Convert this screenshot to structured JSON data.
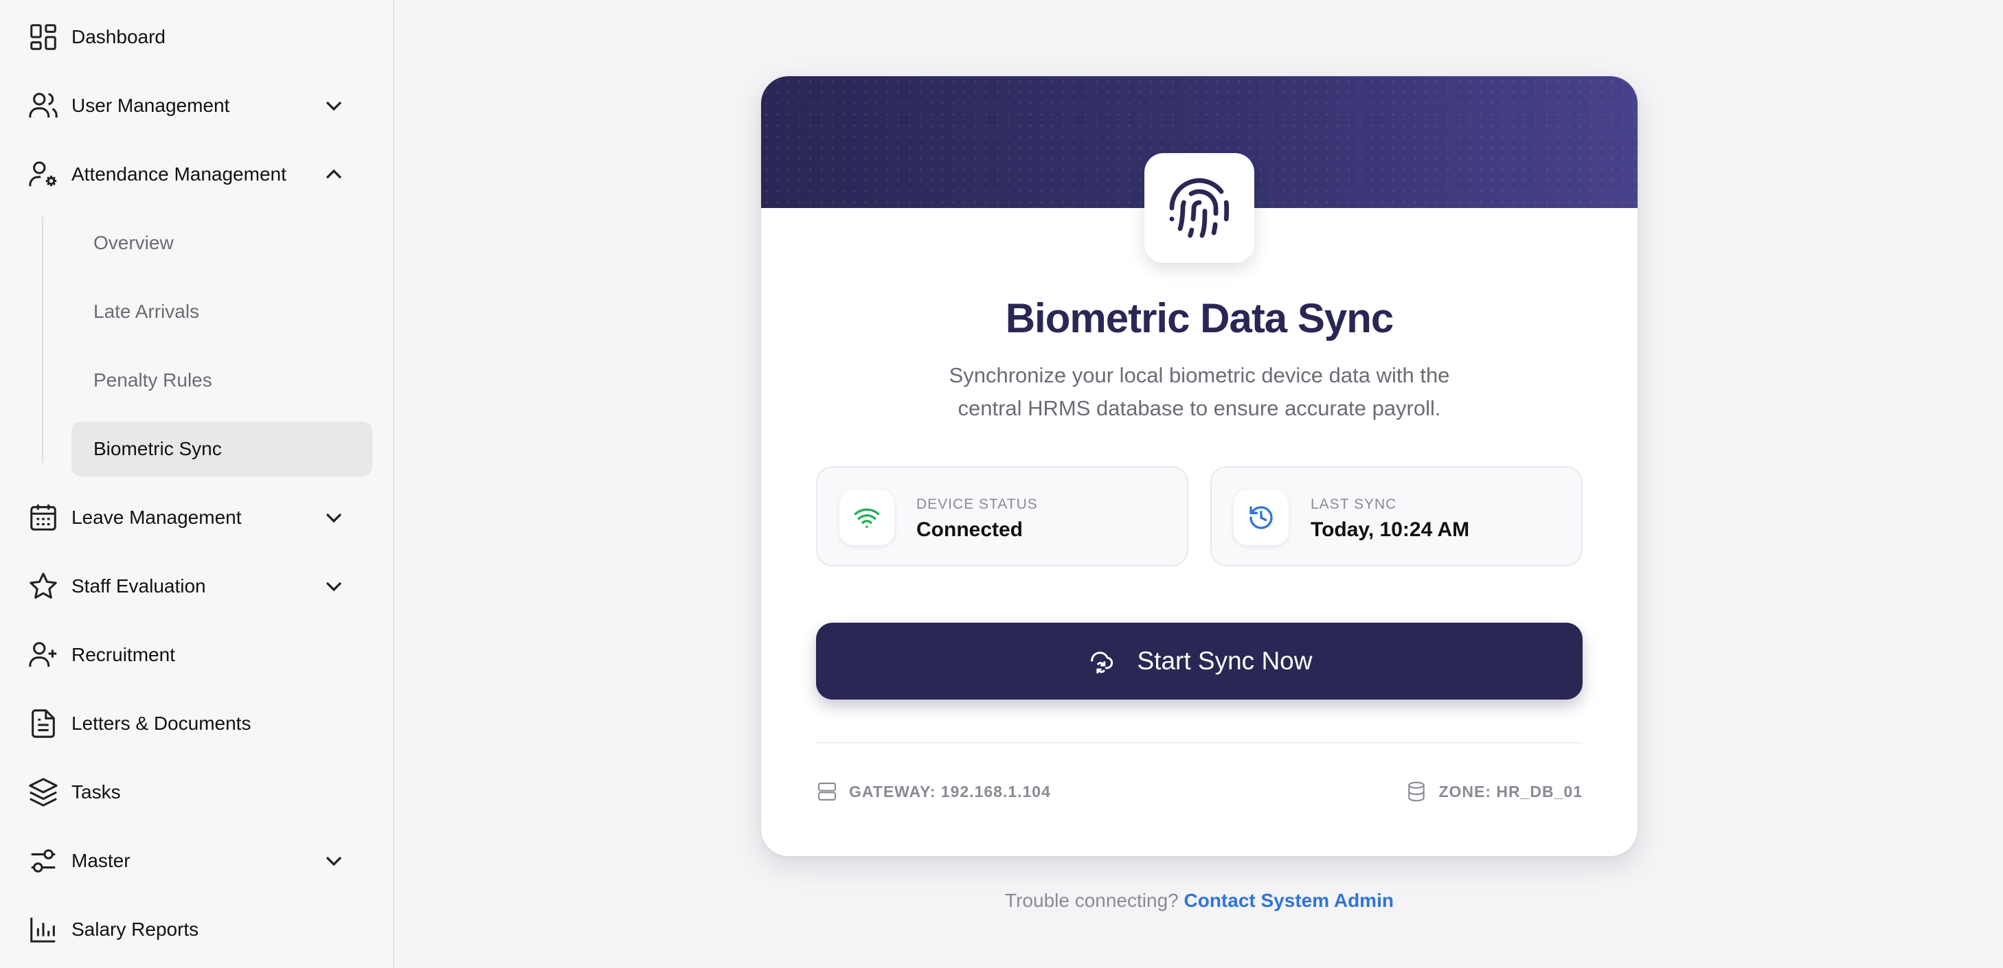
{
  "sidebar": {
    "items": [
      {
        "label": "Dashboard",
        "icon": "dashboard-icon"
      },
      {
        "label": "User Management",
        "icon": "users-icon"
      },
      {
        "label": "Attendance Management",
        "icon": "user-settings-icon"
      },
      {
        "label": "Leave Management",
        "icon": "calendar-icon"
      },
      {
        "label": "Staff Evaluation",
        "icon": "star-icon"
      },
      {
        "label": "Recruitment",
        "icon": "user-plus-icon"
      },
      {
        "label": "Letters & Documents",
        "icon": "document-icon"
      },
      {
        "label": "Tasks",
        "icon": "layers-icon"
      },
      {
        "label": "Master",
        "icon": "sliders-icon"
      },
      {
        "label": "Salary Reports",
        "icon": "bar-chart-icon"
      }
    ],
    "attendance_sub": [
      {
        "label": "Overview"
      },
      {
        "label": "Late Arrivals"
      },
      {
        "label": "Penalty Rules"
      },
      {
        "label": "Biometric Sync",
        "active": true
      }
    ]
  },
  "card": {
    "title": "Biometric Data Sync",
    "description": "Synchronize your local biometric device data with the central HRMS database to ensure accurate payroll.",
    "device_status": {
      "label": "DEVICE STATUS",
      "value": "Connected"
    },
    "last_sync": {
      "label": "LAST SYNC",
      "value": "Today, 10:24 AM"
    },
    "sync_button": "Start Sync Now",
    "gateway": "GATEWAY: 192.168.1.104",
    "zone": "ZONE: HR_DB_01"
  },
  "help": {
    "text": "Trouble connecting?",
    "link": "Contact System Admin"
  },
  "colors": {
    "primary": "#2a2755",
    "connected": "#22b050",
    "sync_icon": "#2f74d8",
    "link": "#2f74d8"
  }
}
